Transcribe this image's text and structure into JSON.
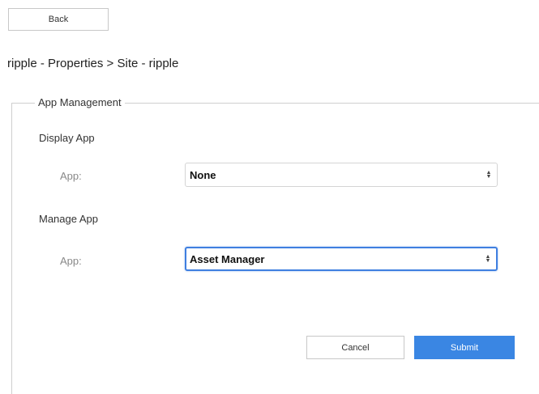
{
  "header": {
    "back_label": "Back",
    "breadcrumb": "ripple - Properties > Site - ripple"
  },
  "app_management": {
    "legend": "App Management",
    "display_app": {
      "title": "Display App",
      "field_label": "App:",
      "selected_value": "None"
    },
    "manage_app": {
      "title": "Manage App",
      "field_label": "App:",
      "selected_value": "Asset Manager"
    }
  },
  "actions": {
    "cancel_label": "Cancel",
    "submit_label": "Submit"
  },
  "colors": {
    "submit_background": "#3a86e3",
    "focus_ring": "#3f7fe0"
  },
  "icons": {
    "select_arrows": "select-arrows-icon"
  }
}
